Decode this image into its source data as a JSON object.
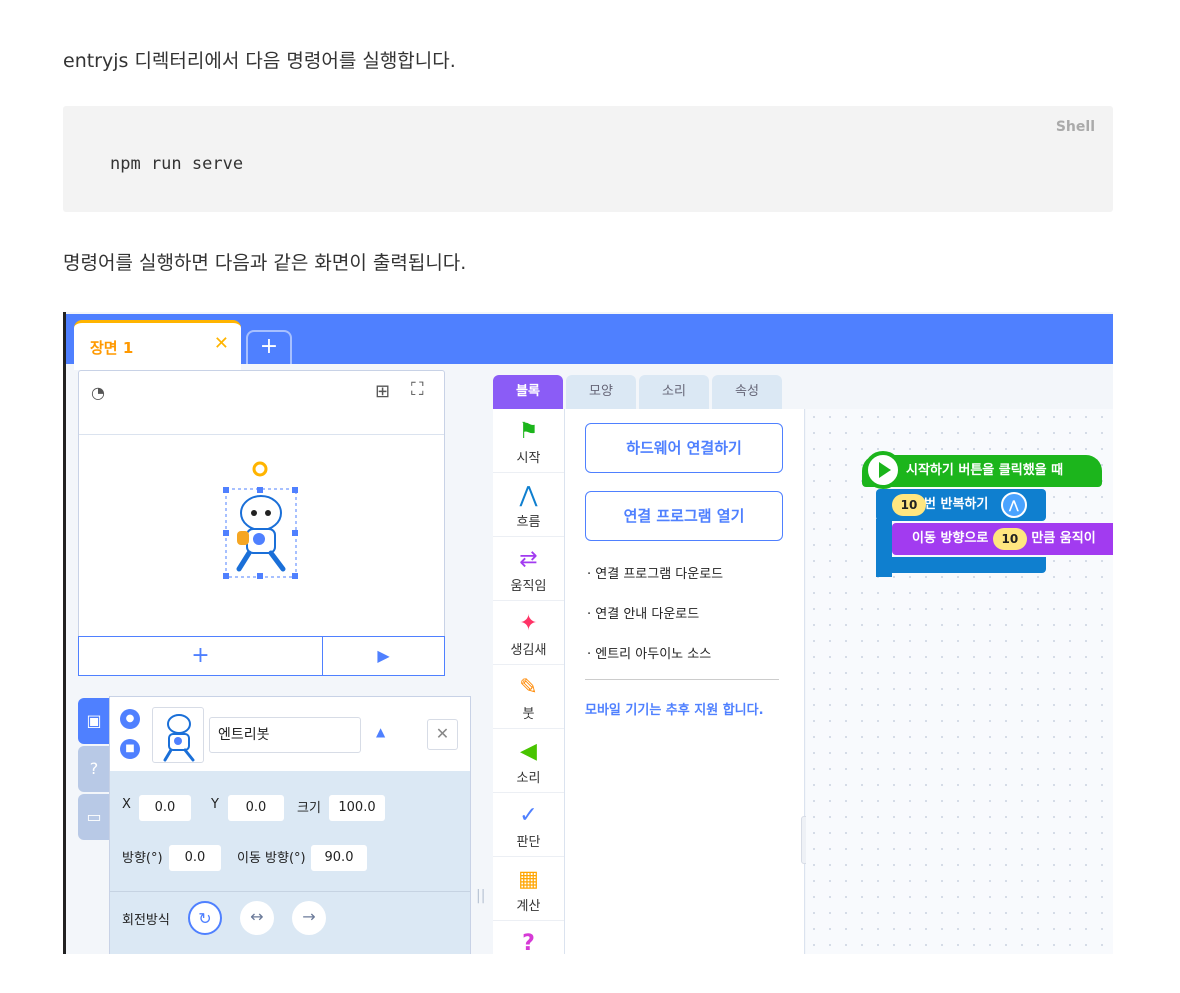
{
  "doc": {
    "intro": "entryjs 디렉터리에서 다음 명령어를 실행합니다.",
    "code_lang": "Shell",
    "code": "npm run serve",
    "after": "명령어를 실행하면 다음과 같은 화면이 출력됩니다."
  },
  "scene": {
    "tab_label": "장면 1",
    "close": "✕",
    "add": "+"
  },
  "stage": {
    "add_button": "+",
    "play_button": "▶"
  },
  "object": {
    "name": "엔트리봇",
    "x_label": "X",
    "x": "0.0",
    "y_label": "Y",
    "y": "0.0",
    "size_label": "크기",
    "size": "100.0",
    "direction_label": "방향(°)",
    "direction": "0.0",
    "move_direction_label": "이동 방향(°)",
    "move_direction": "90.0",
    "rotation_label": "회전방식"
  },
  "block_tabs": [
    "블록",
    "모양",
    "소리",
    "속성"
  ],
  "categories": [
    {
      "label": "시작",
      "icon": "flag-icon",
      "color": "#1cb51c"
    },
    {
      "label": "흐름",
      "icon": "flow-icon",
      "color": "#0f7fcf"
    },
    {
      "label": "움직임",
      "icon": "move-icon",
      "color": "#a23bf0"
    },
    {
      "label": "생김새",
      "icon": "looks-icon",
      "color": "#ff3366"
    },
    {
      "label": "붓",
      "icon": "brush-icon",
      "color": "#ff8800"
    },
    {
      "label": "소리",
      "icon": "speaker-icon",
      "color": "#48c400"
    },
    {
      "label": "판단",
      "icon": "check-icon",
      "color": "#4f80ff"
    },
    {
      "label": "계산",
      "icon": "calc-icon",
      "color": "#ffa500"
    }
  ],
  "palette": {
    "connect_hw": "하드웨어 연결하기",
    "open_program": "연결 프로그램 열기",
    "links": [
      "· 연결 프로그램 다운로드",
      "· 연결 안내 다운로드",
      "· 엔트리 아두이노 소스"
    ],
    "note": "모바일 기기는 추후 지원 합니다."
  },
  "blocks": {
    "start": "시작하기 버튼을 클릭했을 때",
    "repeat_count": "10",
    "repeat": "번 반복하기",
    "move_prefix": "이동 방향으로",
    "move_count": "10",
    "move_suffix": "만큼 움직이"
  }
}
